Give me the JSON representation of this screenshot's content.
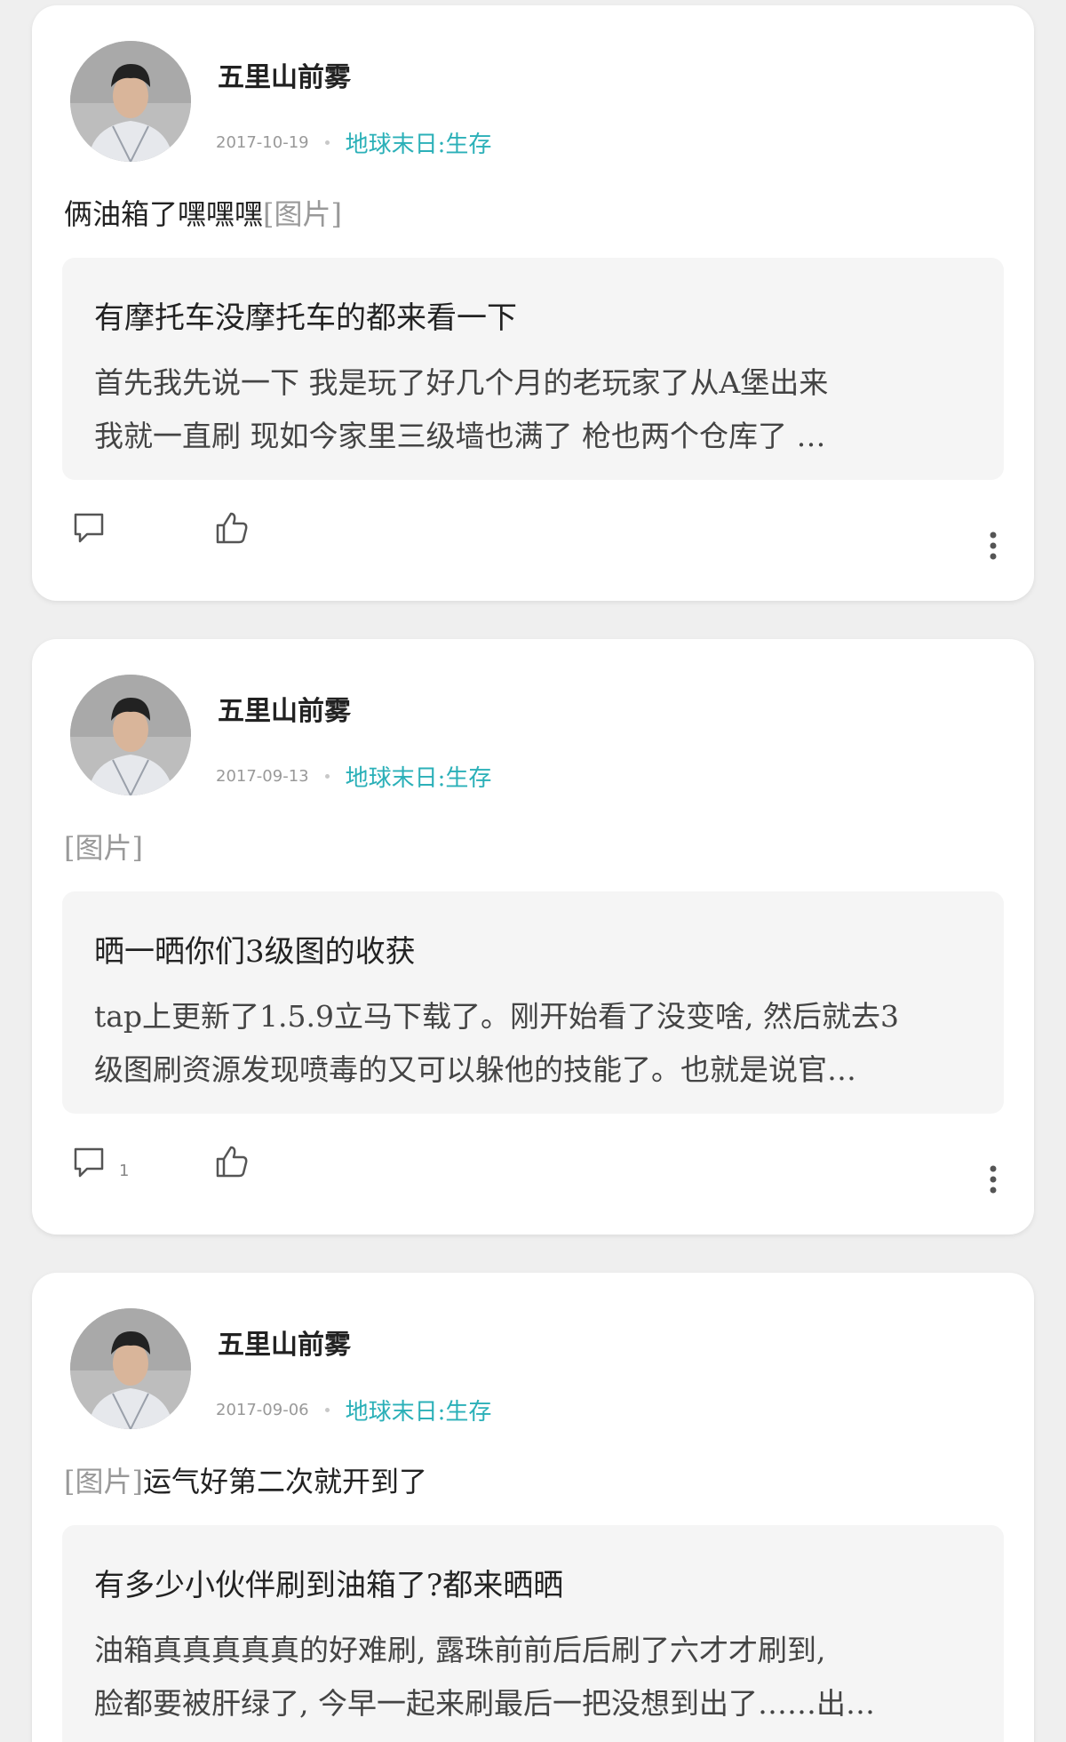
{
  "posts": [
    {
      "author": "五里山前雾",
      "date": "2017-10-19",
      "game": "地球末日:生存",
      "text": "俩油箱了嘿嘿嘿",
      "image_tag": "[图片]",
      "image_first": false,
      "quote": {
        "title": "有摩托车没摩托车的都来看一下",
        "lines": [
          "首先我先说一下 我是玩了好几个月的老玩家了从A堡出来",
          "我就一直刷 现如今家里三级墙也满了 枪也两个仓库了 …"
        ]
      },
      "comment_count": ""
    },
    {
      "author": "五里山前雾",
      "date": "2017-09-13",
      "game": "地球末日:生存",
      "text": "",
      "image_tag": "[图片]",
      "image_first": true,
      "quote": {
        "title": "晒一晒你们3级图的收获",
        "lines": [
          "tap上更新了1.5.9立马下载了。刚开始看了没变啥, 然后就去3",
          "级图刷资源发现喷毒的又可以躲他的技能了。也就是说官…"
        ]
      },
      "comment_count": "1"
    },
    {
      "author": "五里山前雾",
      "date": "2017-09-06",
      "game": "地球末日:生存",
      "text": "运气好第二次就开到了",
      "image_tag": "[图片]",
      "image_first": true,
      "quote": {
        "title": "有多少小伙伴刷到油箱了?都来晒晒",
        "lines": [
          "油箱真真真真真的好难刷, 露珠前前后后刷了六才才刷到,",
          "脸都要被肝绿了, 今早一起来刷最后一把没想到出了……出…"
        ]
      },
      "comment_count": ""
    }
  ],
  "icons": {
    "comment": "comment-icon",
    "like": "thumbs-up-icon",
    "more": "more-vertical-icon"
  },
  "colors": {
    "accent": "#2bb0b8",
    "background": "#efefef",
    "card": "#ffffff",
    "quote_bg": "#f5f5f5"
  }
}
